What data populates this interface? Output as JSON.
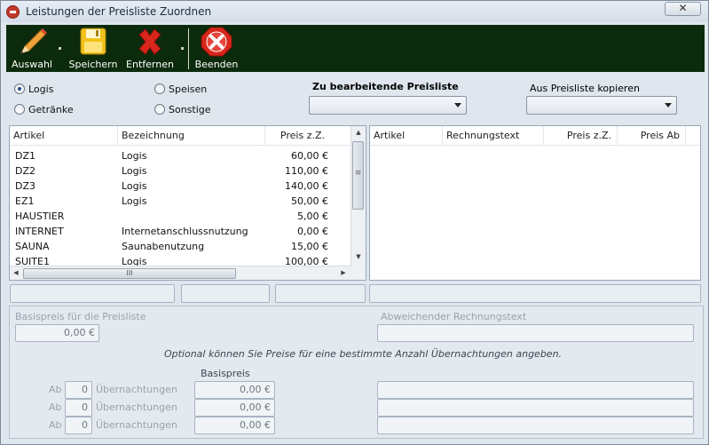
{
  "window": {
    "title": "Leistungen der Preisliste Zuordnen",
    "close_glyph": "✕"
  },
  "toolbar": {
    "buttons": [
      {
        "label": "Auswahl",
        "icon": "pencil-icon"
      },
      {
        "label": "Speichern",
        "icon": "floppy-disk-icon"
      },
      {
        "label": "Entfernen",
        "icon": "red-x-icon"
      },
      {
        "label": "Beenden",
        "icon": "exit-octagon-icon"
      }
    ]
  },
  "categories": {
    "logis": "Logis",
    "speisen": "Speisen",
    "getraenke": "Getränke",
    "sonstige": "Sonstige",
    "selected": "Logis"
  },
  "pricelist": {
    "edit_label": "Zu bearbeitende Preisliste",
    "edit_value": "",
    "copy_label": "Aus Preisliste kopieren",
    "copy_value": ""
  },
  "left_grid": {
    "columns": [
      "Artikel",
      "Bezeichnung",
      "Preis z.Z."
    ],
    "rows": [
      [
        "DZ1",
        "Logis",
        "60,00 €"
      ],
      [
        "DZ2",
        "Logis",
        "110,00 €"
      ],
      [
        "DZ3",
        "Logis",
        "140,00 €"
      ],
      [
        "EZ1",
        "Logis",
        "50,00 €"
      ],
      [
        "HAUSTIER",
        "",
        "5,00 €"
      ],
      [
        "INTERNET",
        "Internetanschlussnutzung",
        "0,00 €"
      ],
      [
        "SAUNA",
        "Saunabenutzung",
        "15,00 €"
      ],
      [
        "SUITE1",
        "Logis",
        "100,00 €"
      ]
    ],
    "hscroll_grip": "III",
    "vscroll_grip": "≡"
  },
  "right_grid": {
    "columns": [
      "Artikel",
      "Rechnungstext",
      "Preis z.Z.",
      "Preis Ab"
    ]
  },
  "details": {
    "basispreis_label": "Basispreis für die Preisliste",
    "basispreis_value": "0,00 €",
    "abweichender_label": "Abweichender Rechnungstext",
    "abweichender_value": "",
    "optional_note": "Optional können Sie Preise für eine bestimmte Anzahl Übernachtungen angeben.",
    "basispreis_col_header": "Basispreis",
    "tiers": [
      {
        "ab": "Ab",
        "count": "0",
        "unit": "Übernachtungen",
        "price": "0,00 €"
      },
      {
        "ab": "Ab",
        "count": "0",
        "unit": "Übernachtungen",
        "price": "0,00 €"
      },
      {
        "ab": "Ab",
        "count": "0",
        "unit": "Übernachtungen",
        "price": "0,00 €"
      }
    ]
  },
  "colors": {
    "toolbar_bg": "#0c2b0c",
    "accent_red": "#d9261c",
    "selection_blue": "#1b4f8c"
  }
}
